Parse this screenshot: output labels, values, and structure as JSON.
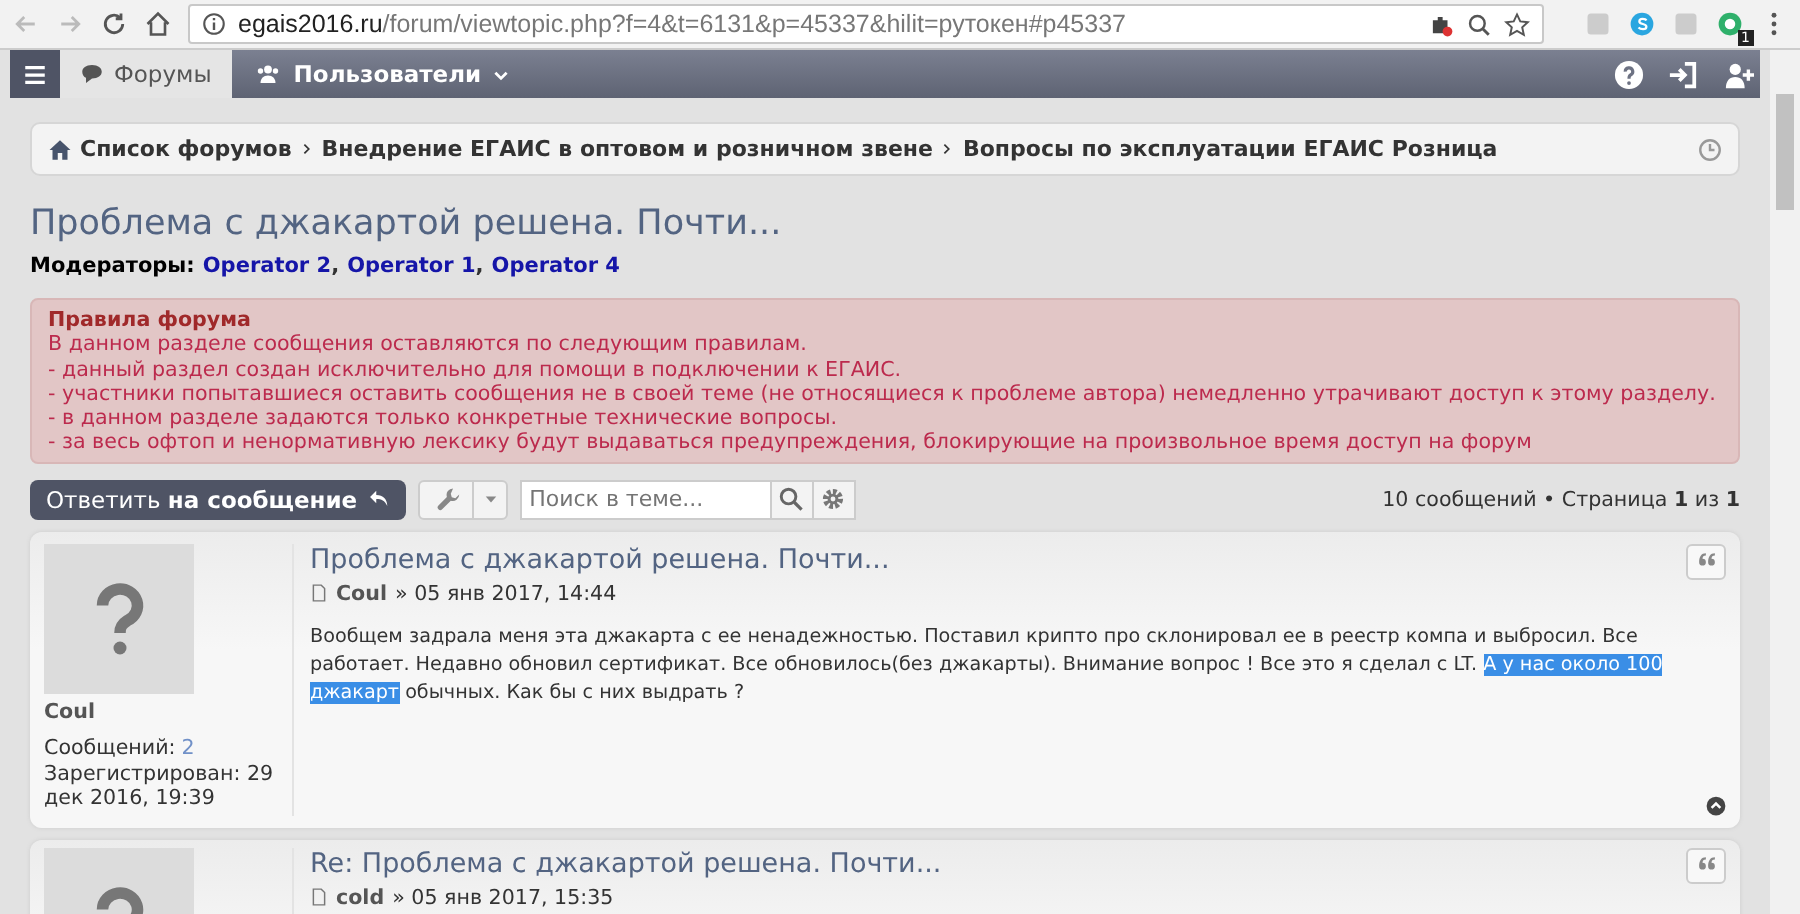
{
  "browser": {
    "url_host": "egais2016.ru",
    "url_path": "/forum/viewtopic.php?f=4&t=6131&p=45337&hilit=рутокен#p45337",
    "extension_badge": "1"
  },
  "navbar": {
    "items": [
      {
        "label": "Форумы",
        "selected": true,
        "kind": "tab"
      },
      {
        "label": "Пользователи",
        "selected": false,
        "kind": "dropdown"
      }
    ]
  },
  "breadcrumbs": [
    "Список форумов",
    "Внедрение ЕГАИС в оптовом и розничном звене",
    "Вопросы по эксплуатации ЕГАИС Розница"
  ],
  "topic_title": "Проблема с джакартой решена. Почти...",
  "moderators": {
    "label": "Модераторы:",
    "names": [
      "Operator 2",
      "Operator 1",
      "Operator 4"
    ],
    "separator": ","
  },
  "rules": {
    "title": "Правила форума",
    "lines": [
      "В данном разделе сообщения оставляются по следующим правилам.",
      "- данный раздел создан исключительно для помощи в подключении к ЕГАИС.",
      "- участники попытавшиеся оставить сообщения не в своей теме (не относящиеся к проблеме автора) немедленно утрачивают доступ к этому разделу.",
      "- в данном разделе задаются только конкретные технические вопросы.",
      "- за весь офтоп и ненормативную лексику будут выдаваться предупреждения, блокирующие на произвольное время доступ на форум"
    ]
  },
  "toolbar": {
    "reply_button": "Ответить **на сообщение**",
    "search_placeholder": "Поиск в теме...",
    "pagination": "10 сообщений • Страница **1** из **1**"
  },
  "posts": [
    {
      "title": "Проблема с джакартой решена. Почти...",
      "author": "Coul",
      "date": "» 05 янв 2017, 14:44",
      "content": [
        {
          "text": "Вообщем задрала меня эта джакарта с ее ненадежностью. Поставил крипто про склонировал ее в реестр компа и выбросил. Все работает. Недавно обновил сертификат. Все обновилось(без джакарты). Внимание вопрос ! Все это я сделал с LT. ",
          "highlighted": false
        },
        {
          "text": "А у нас около 100 джакарт",
          "highlighted": true
        },
        {
          "text": " обычных. Как бы с них выдрать ?",
          "highlighted": false
        }
      ],
      "profile": {
        "username": "Coul",
        "posts_label": "Сообщений:",
        "posts_count": "2",
        "registered_label": "Зарегистрирован:",
        "registered": "29 дек 2016, 19:39"
      }
    },
    {
      "title": "Re: Проблема с джакартой решена. Почти...",
      "author": "cold",
      "date": "» 05 янв 2017, 15:35"
    }
  ]
}
